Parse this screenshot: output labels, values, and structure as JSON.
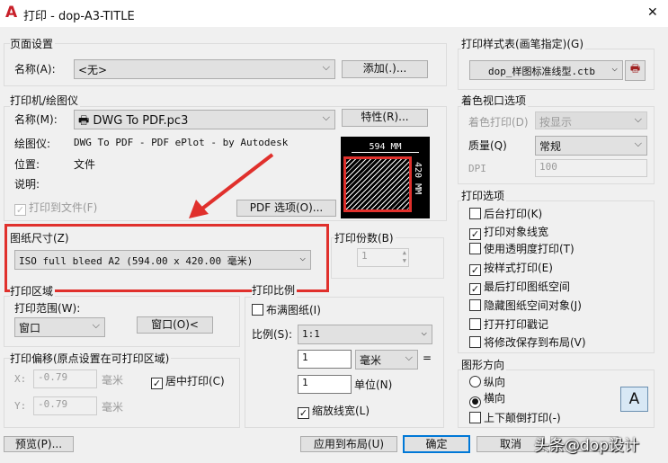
{
  "window": {
    "title": "打印 - dop-A3-TITLE",
    "close": "✕"
  },
  "page_setup": {
    "group": "页面设置",
    "name_label": "名称(A):",
    "name_value": "<无>",
    "add_button": "添加(.)..."
  },
  "printer": {
    "group": "打印机/绘图仪",
    "name_label": "名称(M):",
    "name_value": "DWG To PDF.pc3",
    "properties_button": "特性(R)...",
    "plotter_label": "绘图仪:",
    "plotter_value": "DWG To PDF - PDF ePlot - by Autodesk",
    "location_label": "位置:",
    "location_value": "文件",
    "description_label": "说明:",
    "plot_to_file": "打印到文件(F)",
    "pdf_options_button": "PDF 选项(O)...",
    "preview_width": "594 MM",
    "preview_height": "420 MM"
  },
  "paper_size": {
    "label": "图纸尺寸(Z)",
    "value": "ISO full bleed A2 (594.00 x 420.00 毫米)"
  },
  "copies": {
    "label": "打印份数(B)",
    "value": "1"
  },
  "plot_area": {
    "group": "打印区域",
    "range_label": "打印范围(W):",
    "range_value": "窗口",
    "window_button": "窗口(O)<"
  },
  "plot_offset": {
    "group": "打印偏移(原点设置在可打印区域)",
    "x_label": "X:",
    "x_value": "-0.79",
    "y_label": "Y:",
    "y_value": "-0.79",
    "unit": "毫米",
    "center": "居中打印(C)"
  },
  "plot_scale": {
    "group": "打印比例",
    "fit": "布满图纸(I)",
    "scale_label": "比例(S):",
    "scale_value": "1:1",
    "value1": "1",
    "unit_value": "毫米",
    "equals": "=",
    "value2": "1",
    "units_label": "单位(N)",
    "scale_lineweights": "缩放线宽(L)"
  },
  "style_table": {
    "group": "打印样式表(画笔指定)(G)",
    "value": "dop_样图标准线型.ctb"
  },
  "shaded": {
    "group": "着色视口选项",
    "shade_label": "着色打印(D)",
    "shade_value": "按显示",
    "quality_label": "质量(Q)",
    "quality_value": "常规",
    "dpi_label": "DPI",
    "dpi_value": "100"
  },
  "options": {
    "group": "打印选项",
    "items": [
      {
        "label": "后台打印(K)",
        "checked": false
      },
      {
        "label": "打印对象线宽",
        "checked": true
      },
      {
        "label": "使用透明度打印(T)",
        "checked": false
      },
      {
        "label": "按样式打印(E)",
        "checked": true
      },
      {
        "label": "最后打印图纸空间",
        "checked": true
      },
      {
        "label": "隐藏图纸空间对象(J)",
        "checked": false
      },
      {
        "label": "打开打印戳记",
        "checked": false
      },
      {
        "label": "将修改保存到布局(V)",
        "checked": false
      }
    ]
  },
  "orientation": {
    "group": "图形方向",
    "portrait": "纵向",
    "landscape": "横向",
    "upside_down": "上下颠倒打印(-)",
    "icon_letter": "A"
  },
  "buttons": {
    "preview": "预览(P)...",
    "apply": "应用到布局(U)",
    "ok": "确定",
    "cancel": "取消"
  },
  "watermark": "头条@dop设计",
  "colors": {
    "highlight": "#e0302c",
    "accent": "#0078d7"
  }
}
